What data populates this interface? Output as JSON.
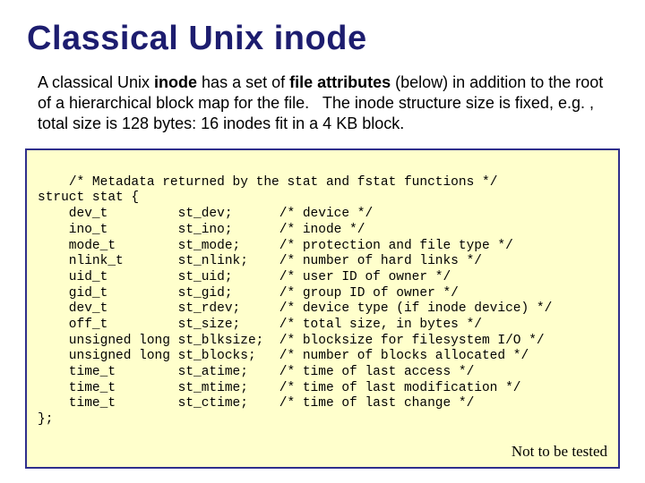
{
  "title": "Classical Unix inode",
  "body": {
    "segments": [
      "A classical Unix ",
      "inode",
      " has a set of ",
      "file attributes",
      " (below) in addition to the root of a hierarchical block map for the file.   The inode structure size is fixed, e.g. , total size is 128 bytes: 16 inodes fit in a 4 KB block."
    ]
  },
  "code": "/* Metadata returned by the stat and fstat functions */\nstruct stat {\n    dev_t         st_dev;      /* device */\n    ino_t         st_ino;      /* inode */\n    mode_t        st_mode;     /* protection and file type */\n    nlink_t       st_nlink;    /* number of hard links */\n    uid_t         st_uid;      /* user ID of owner */\n    gid_t         st_gid;      /* group ID of owner */\n    dev_t         st_rdev;     /* device type (if inode device) */\n    off_t         st_size;     /* total size, in bytes */\n    unsigned long st_blksize;  /* blocksize for filesystem I/O */\n    unsigned long st_blocks;   /* number of blocks allocated */\n    time_t        st_atime;    /* time of last access */\n    time_t        st_mtime;    /* time of last modification */\n    time_t        st_ctime;    /* time of last change */\n};",
  "note": "Not to be tested"
}
